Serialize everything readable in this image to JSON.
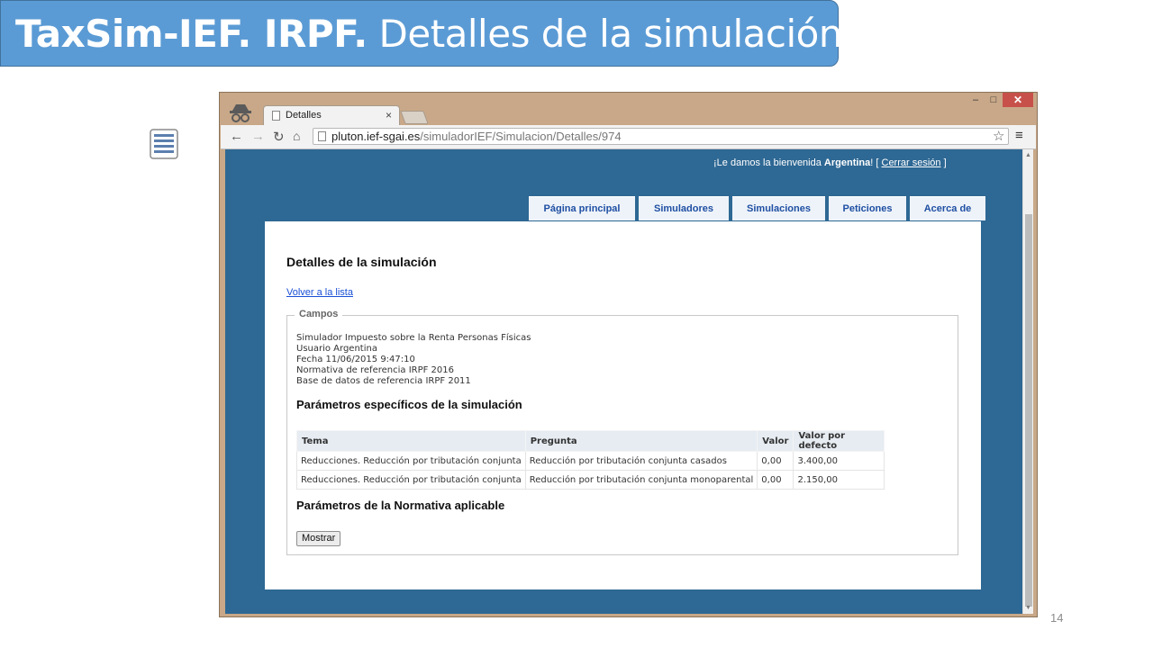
{
  "slide": {
    "title_bold": "TaxSim-IEF. IRPF.",
    "title_rest": " Detalles de la simulación",
    "page_number": "14"
  },
  "browser": {
    "tab_title": "Detalles",
    "tab_close": "×",
    "url_host": "pluton.ief-sgai.es",
    "url_path": "/simuladorIEF/Simulacion/Detalles/974",
    "win_minimize": "–",
    "win_maximize": "□",
    "win_close": "✕"
  },
  "header": {
    "welcome_prefix": "¡Le damos la bienvenida ",
    "user_name": "Argentina",
    "welcome_suffix": "! [ ",
    "logout_label": "Cerrar sesión",
    "bracket_close": " ]"
  },
  "nav": {
    "tabs": [
      {
        "label": "Página principal"
      },
      {
        "label": "Simuladores"
      },
      {
        "label": "Simulaciones"
      },
      {
        "label": "Peticiones"
      },
      {
        "label": "Acerca de"
      }
    ]
  },
  "main": {
    "heading": "Detalles de la simulación",
    "back_link": "Volver a la lista",
    "fieldset_legend": "Campos",
    "info": [
      "Simulador Impuesto sobre la Renta Personas Físicas",
      "Usuario Argentina",
      "Fecha 11/06/2015 9:47:10",
      "Normativa de referencia IRPF 2016",
      "Base de datos de referencia IRPF 2011"
    ],
    "specific_params_heading": "Parámetros específicos de la simulación",
    "table": {
      "headers": [
        "Tema",
        "Pregunta",
        "Valor",
        "Valor por defecto"
      ],
      "rows": [
        [
          "Reducciones. Reducción por tributación conjunta",
          "Reducción por tributación conjunta casados",
          "0,00",
          "3.400,00"
        ],
        [
          "Reducciones. Reducción por tributación conjunta",
          "Reducción por tributación conjunta monoparental",
          "0,00",
          "2.150,00"
        ]
      ]
    },
    "regulation_params_heading": "Parámetros de la Normativa aplicable",
    "show_button": "Mostrar"
  },
  "colors": {
    "banner": "#5b9bd5",
    "page_background": "#2e6894",
    "nav_tab_text": "#1f4fa3",
    "link": "#1a4fd6"
  },
  "icons": [
    "document-list-icon",
    "incognito-icon",
    "back-arrow-icon",
    "forward-arrow-icon",
    "reload-icon",
    "home-icon",
    "star-icon",
    "menu-icon"
  ]
}
